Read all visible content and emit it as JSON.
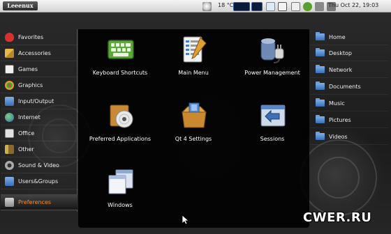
{
  "panel": {
    "logo": "Leeenux",
    "weather": "18 °C",
    "clock": "Thu Oct 22, 19:03"
  },
  "categories": [
    {
      "label": "Favorites",
      "icon": "heart-icon",
      "color": "#d9322e"
    },
    {
      "label": "Accessories",
      "icon": "accessories-icon",
      "color": "#e8b84a"
    },
    {
      "label": "Games",
      "icon": "cards-icon",
      "color": "#e9e9e9"
    },
    {
      "label": "Graphics",
      "icon": "palette-icon",
      "color": "#e39a2c"
    },
    {
      "label": "Input/Output",
      "icon": "folder-icon",
      "color": "#4e86cf"
    },
    {
      "label": "Internet",
      "icon": "globe-icon",
      "color": "#3e8a4a"
    },
    {
      "label": "Office",
      "icon": "office-icon",
      "color": "#d6d6d6"
    },
    {
      "label": "Other",
      "icon": "tools-icon",
      "color": "#c9b24a"
    },
    {
      "label": "Sound & Video",
      "icon": "speaker-icon",
      "color": "#aaaaaa"
    },
    {
      "label": "Users&Groups",
      "icon": "folder-icon",
      "color": "#4e86cf"
    },
    {
      "label": "Preferences",
      "icon": "preferences-icon",
      "color": "#cfcfcf"
    }
  ],
  "active_category": "Preferences",
  "apps": [
    {
      "label": "Keyboard Shortcuts",
      "icon": "keyboard-icon"
    },
    {
      "label": "Main Menu",
      "icon": "menu-editor-icon"
    },
    {
      "label": "Power Management",
      "icon": "power-plug-icon"
    },
    {
      "label": "Preferred Applications",
      "icon": "preferred-apps-icon"
    },
    {
      "label": "Qt 4 Settings",
      "icon": "qt-box-icon"
    },
    {
      "label": "Sessions",
      "icon": "sessions-icon"
    },
    {
      "label": "Windows",
      "icon": "windows-icon"
    }
  ],
  "places": [
    {
      "label": "Home"
    },
    {
      "label": "Desktop"
    },
    {
      "label": "Network"
    },
    {
      "label": "Documents"
    },
    {
      "label": "Music"
    },
    {
      "label": "Pictures"
    },
    {
      "label": "Videos"
    }
  ],
  "watermark": "CWER.RU",
  "colors": {
    "active_text": "#ff8a2b",
    "panel_bg": "#e4e4e4",
    "menu_bg": "#000000"
  }
}
